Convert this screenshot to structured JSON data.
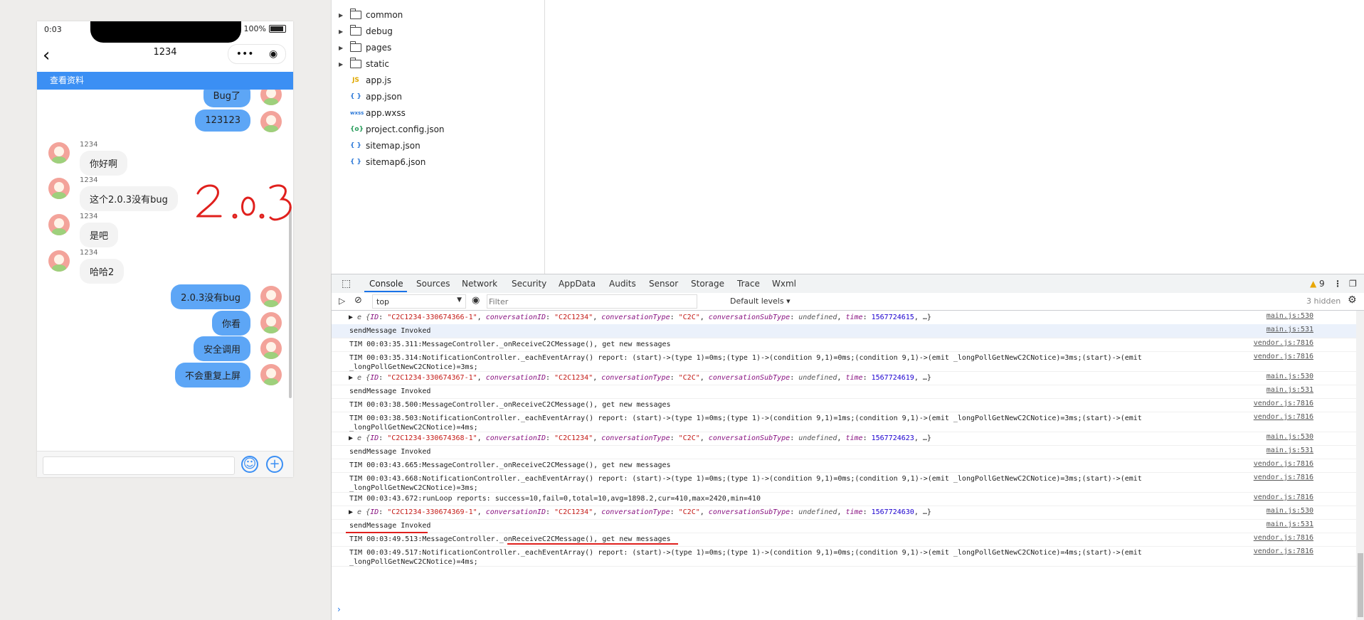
{
  "phone": {
    "status_time": "0:03",
    "battery_text": "100%",
    "nav_title": "1234",
    "banner": "查看资料"
  },
  "chat": {
    "messages": [
      {
        "side": "right",
        "text": "Bug了"
      },
      {
        "side": "right",
        "text": "123123"
      },
      {
        "side": "left",
        "nick": "1234",
        "text": "你好啊"
      },
      {
        "side": "left",
        "nick": "1234",
        "text": "这个2.0.3没有bug"
      },
      {
        "side": "left",
        "nick": "1234",
        "text": "是吧"
      },
      {
        "side": "left",
        "nick": "1234",
        "text": "哈哈2"
      },
      {
        "side": "right",
        "text": "2.0.3没有bug"
      },
      {
        "side": "right",
        "text": "你看"
      },
      {
        "side": "right",
        "text": "安全调用"
      },
      {
        "side": "right",
        "text": "不会重复上屏"
      }
    ],
    "annotation": "2.0.3",
    "annotation_color": "#e0201d"
  },
  "files": [
    {
      "type": "folder",
      "name": "common"
    },
    {
      "type": "folder",
      "name": "debug"
    },
    {
      "type": "folder",
      "name": "pages"
    },
    {
      "type": "folder",
      "name": "static"
    },
    {
      "type": "js",
      "name": "app.js",
      "icon": "JS"
    },
    {
      "type": "json",
      "name": "app.json",
      "icon": "{ }"
    },
    {
      "type": "wxss",
      "name": "app.wxss",
      "icon": "wxss"
    },
    {
      "type": "config",
      "name": "project.config.json",
      "icon": "{o}"
    },
    {
      "type": "json",
      "name": "sitemap.json",
      "icon": "{ }"
    },
    {
      "type": "json",
      "name": "sitemap6.json",
      "icon": "{ }"
    }
  ],
  "devtools": {
    "tabs": [
      "Console",
      "Sources",
      "Network",
      "Security",
      "AppData",
      "Audits",
      "Sensor",
      "Storage",
      "Trace",
      "Wxml"
    ],
    "warning_count": "9",
    "context": "top",
    "filter_placeholder": "Filter",
    "levels": "Default levels",
    "hidden": "3 hidden",
    "accent": "#1a73e8",
    "logs": [
      {
        "kind": "obj",
        "id": "\"C2C1234-330674366-1\"",
        "time": "1567724615",
        "src": "main.js:530"
      },
      {
        "kind": "text",
        "text": "sendMessage Invoked",
        "src": "main.js:531",
        "hl": true
      },
      {
        "kind": "text",
        "text": "TIM 00:03:35.311:MessageController._onReceiveC2CMessage(), get new messages",
        "src": "vendor.js:7816"
      },
      {
        "kind": "text2",
        "text": "TIM 00:03:35.314:NotificationController._eachEventArray() report: (start)->(type 1)=0ms;(type 1)->(condition 9,1)=0ms;(condition 9,1)->(emit _longPollGetNewC2CNotice)=3ms;(start)->(emit",
        "text2": "_longPollGetNewC2CNotice)=3ms;",
        "src": "vendor.js:7816"
      },
      {
        "kind": "obj",
        "id": "\"C2C1234-330674367-1\"",
        "time": "1567724619",
        "src": "main.js:530"
      },
      {
        "kind": "text",
        "text": "sendMessage Invoked",
        "src": "main.js:531"
      },
      {
        "kind": "text",
        "text": "TIM 00:03:38.500:MessageController._onReceiveC2CMessage(), get new messages",
        "src": "vendor.js:7816"
      },
      {
        "kind": "text2",
        "text": "TIM 00:03:38.503:NotificationController._eachEventArray() report: (start)->(type 1)=0ms;(type 1)->(condition 9,1)=1ms;(condition 9,1)->(emit _longPollGetNewC2CNotice)=3ms;(start)->(emit",
        "text2": "_longPollGetNewC2CNotice)=4ms;",
        "src": "vendor.js:7816"
      },
      {
        "kind": "obj",
        "id": "\"C2C1234-330674368-1\"",
        "time": "1567724623",
        "src": "main.js:530"
      },
      {
        "kind": "text",
        "text": "sendMessage Invoked",
        "src": "main.js:531"
      },
      {
        "kind": "text",
        "text": "TIM 00:03:43.665:MessageController._onReceiveC2CMessage(), get new messages",
        "src": "vendor.js:7816"
      },
      {
        "kind": "text2",
        "text": "TIM 00:03:43.668:NotificationController._eachEventArray() report: (start)->(type 1)=0ms;(type 1)->(condition 9,1)=0ms;(condition 9,1)->(emit _longPollGetNewC2CNotice)=3ms;(start)->(emit",
        "text2": "_longPollGetNewC2CNotice)=3ms;",
        "src": "vendor.js:7816"
      },
      {
        "kind": "text",
        "text": "TIM 00:03:43.672:runLoop reports: success=10,fail=0,total=10,avg=1898.2,cur=410,max=2420,min=410",
        "src": "vendor.js:7816"
      },
      {
        "kind": "obj",
        "id": "\"C2C1234-330674369-1\"",
        "time": "1567724630",
        "src": "main.js:530"
      },
      {
        "kind": "text",
        "text": "sendMessage Invoked",
        "src": "main.js:531",
        "underline": true
      },
      {
        "kind": "text",
        "text": "TIM 00:03:49.513:MessageController._onReceiveC2CMessage(), get new messages",
        "src": "vendor.js:7816",
        "underline2": true
      },
      {
        "kind": "text2",
        "text": "TIM 00:03:49.517:NotificationController._eachEventArray() report: (start)->(type 1)=0ms;(type 1)->(condition 9,1)=0ms;(condition 9,1)->(emit _longPollGetNewC2CNotice)=4ms;(start)->(emit",
        "text2": "_longPollGetNewC2CNotice)=4ms;",
        "src": "vendor.js:7816"
      }
    ],
    "obj_labels": {
      "conv_id_key": "conversationID",
      "conv_id": "\"C2C1234\"",
      "type_key": "conversationType",
      "type_val": "\"C2C\"",
      "subtype_key": "conversationSubType",
      "subtype_val": "undefined",
      "time_key": "time",
      "id_key": "ID",
      "prefix": "e",
      "ellipsis": "…"
    }
  }
}
